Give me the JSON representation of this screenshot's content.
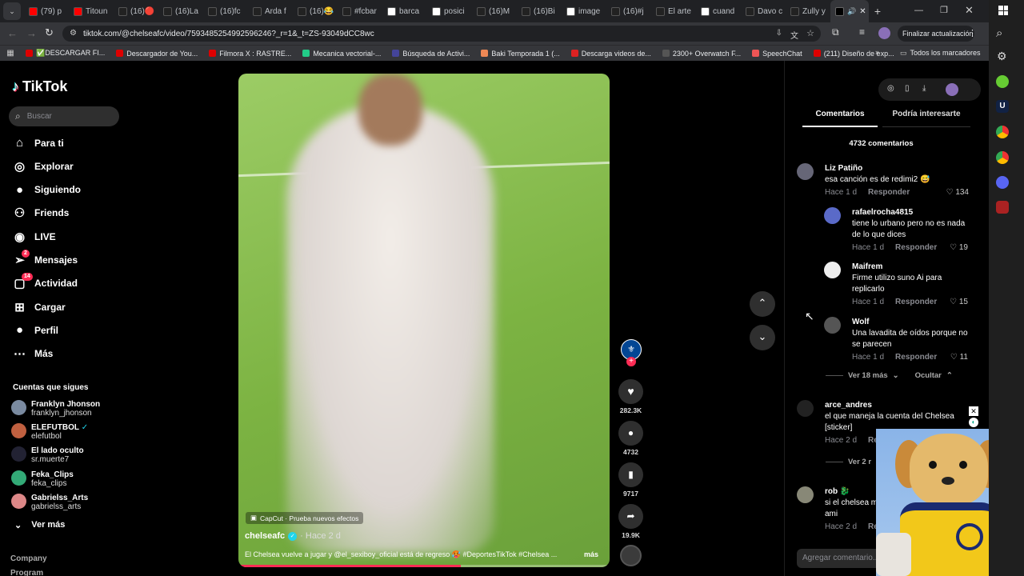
{
  "tabs": [
    {
      "label": "(79) p",
      "color": "#ff0000"
    },
    {
      "label": "Titoun",
      "color": "#ff0000"
    },
    {
      "label": "(16)🔴",
      "color": "#222"
    },
    {
      "label": "(16)La",
      "color": "#222"
    },
    {
      "label": "(16)fc",
      "color": "#222"
    },
    {
      "label": "Arda f",
      "color": "#222"
    },
    {
      "label": "(16)😂",
      "color": "#222"
    },
    {
      "label": "#fcbar",
      "color": "#222"
    },
    {
      "label": "barca",
      "color": "#fff"
    },
    {
      "label": "posici",
      "color": "#fff"
    },
    {
      "label": "(16)M",
      "color": "#222"
    },
    {
      "label": "(16)Bi",
      "color": "#222"
    },
    {
      "label": "image",
      "color": "#fff"
    },
    {
      "label": "(16)#j",
      "color": "#222"
    },
    {
      "label": "El arte",
      "color": "#222"
    },
    {
      "label": "cuand",
      "color": "#fff"
    },
    {
      "label": "Davo c",
      "color": "#222"
    },
    {
      "label": "Zully y",
      "color": "#222"
    }
  ],
  "active_tab": {
    "label": ""
  },
  "address": "tiktok.com/@chelseafc/video/7593485254992596246?_r=1&_t=ZS-93049dCC8wc",
  "update_button": "Finalizar actualización",
  "bookmarks": [
    {
      "label": "✅DESCARGAR FI...",
      "color": "#d00"
    },
    {
      "label": "Descargador de You...",
      "color": "#d00"
    },
    {
      "label": "Filmora X : RASTRE...",
      "color": "#d00"
    },
    {
      "label": "Mecanica vectorial-...",
      "color": "#2c8"
    },
    {
      "label": "Búsqueda de Activi...",
      "color": "#449"
    },
    {
      "label": "Baki Temporada 1 (...",
      "color": "#e85"
    },
    {
      "label": "Descarga videos de...",
      "color": "#d22"
    },
    {
      "label": "2300+ Overwatch F...",
      "color": "#555"
    },
    {
      "label": "SpeechChat",
      "color": "#e55"
    },
    {
      "label": "(211) Diseño de exp...",
      "color": "#d00"
    }
  ],
  "all_bookmarks": "Todos los marcadores",
  "logo": "TikTok",
  "search_placeholder": "Buscar",
  "nav": [
    {
      "label": "Para ti",
      "icon": "home-icon"
    },
    {
      "label": "Explorar",
      "icon": "compass-icon"
    },
    {
      "label": "Siguiendo",
      "icon": "following-icon"
    },
    {
      "label": "Friends",
      "icon": "friends-icon"
    },
    {
      "label": "LIVE",
      "icon": "live-icon"
    },
    {
      "label": "Mensajes",
      "icon": "messages-icon",
      "badge": "2"
    },
    {
      "label": "Actividad",
      "icon": "activity-icon",
      "badge": "14"
    },
    {
      "label": "Cargar",
      "icon": "upload-icon"
    },
    {
      "label": "Perfil",
      "icon": "profile-icon"
    },
    {
      "label": "Más",
      "icon": "more-icon"
    }
  ],
  "following_header": "Cuentas que sigues",
  "following": [
    {
      "name": "Franklyn Jhonson",
      "handle": "franklyn_jhonson",
      "color": "#7a8aa0"
    },
    {
      "name": "ELEFUTBOL",
      "handle": "elefutbol",
      "color": "#c06040",
      "verified": true
    },
    {
      "name": "El lado oculto",
      "handle": "sr.muerte7",
      "color": "#223"
    },
    {
      "name": "Feka_Clips",
      "handle": "feka_clips",
      "color": "#3a7"
    },
    {
      "name": "Gabrielss_Arts",
      "handle": "gabrielss_arts",
      "color": "#d88"
    }
  ],
  "see_more": "Ver más",
  "footer_links": [
    "Company",
    "Program"
  ],
  "video": {
    "effect_label": "CapCut · Prueba nuevos efectos",
    "author": "chelseafc",
    "time": "· Hace 2 d",
    "caption": "El Chelsea vuelve a jugar y @el_sexiboy_oficial está de regreso 🥵 #DeportesTikTok #Chelsea ...",
    "more": "más"
  },
  "actions": {
    "likes": "282.3K",
    "comments": "4732",
    "saves": "9717",
    "shares": "19.9K"
  },
  "panel": {
    "tab_comments": "Comentarios",
    "tab_interest": "Podría interesarte",
    "count_label": "4732 comentarios",
    "reply_label": "Responder",
    "add_placeholder": "Agregar comentario...",
    "view_more": "Ver 18 más",
    "hide": "Ocultar",
    "view_more2": "Ver 2 r"
  },
  "comments": [
    {
      "name": "Liz Patiño",
      "text": "esa canción es de redimi2 😅",
      "time": "Hace 1 d",
      "likes": "134"
    },
    {
      "name": "rafaelrocha4815",
      "text": "tiene lo urbano pero no es nada de lo que dices",
      "time": "Hace 1 d",
      "likes": "19"
    },
    {
      "name": "Maifrem",
      "text": "Firme utilizo suno Ai para replicarlo",
      "time": "Hace 1 d",
      "likes": "15"
    },
    {
      "name": "Wolf",
      "text": "Una lavadita de oídos porque no se parecen",
      "time": "Hace 1 d",
      "likes": "11"
    },
    {
      "name": "arce_andres",
      "text": "el que maneja la cuenta del Chelsea [sticker]",
      "time": "Hace 2 d",
      "likes": ""
    },
    {
      "name": "rob 🐉",
      "text": "si el chelsea m a mi mejor ami",
      "time": "Hace 2 d",
      "likes": ""
    }
  ]
}
